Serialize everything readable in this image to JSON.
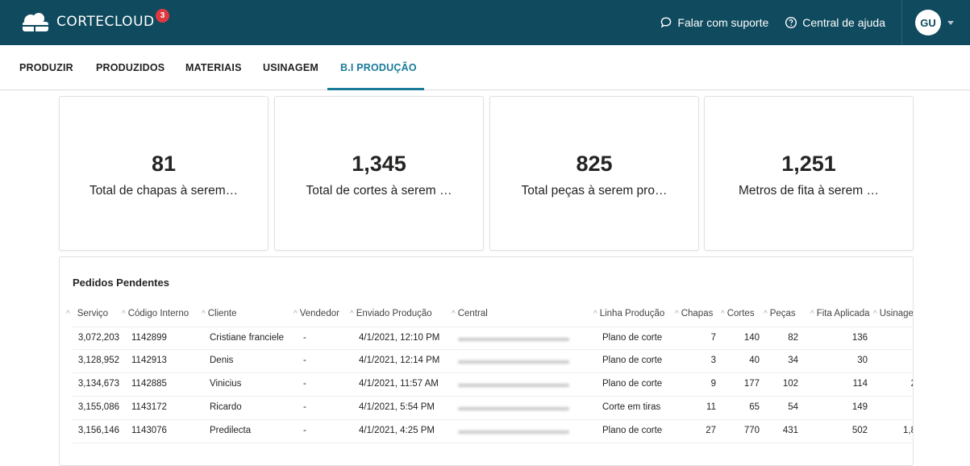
{
  "app": {
    "name": "CORTECLOUD",
    "notification_count": "3",
    "colors": {
      "topbar": "#0f4a5e",
      "accent": "#1a7a9a",
      "badge": "#e0383e"
    }
  },
  "header": {
    "support_label": "Falar com suporte",
    "help_label": "Central de ajuda",
    "user_initials": "GU"
  },
  "tabs": [
    {
      "label": "PRODUZIR"
    },
    {
      "label": "PRODUZIDOS"
    },
    {
      "label": "MATERIAIS"
    },
    {
      "label": "USINAGEM"
    },
    {
      "label": "B.I PRODUÇÃO",
      "active": true
    }
  ],
  "kpis": [
    {
      "value": "81",
      "label": "Total de chapas à serem…"
    },
    {
      "value": "1,345",
      "label": "Total de cortes à serem …"
    },
    {
      "value": "825",
      "label": "Total peças à serem pro…"
    },
    {
      "value": "1,251",
      "label": "Metros de fita à serem …"
    }
  ],
  "table": {
    "title": "Pedidos Pendentes",
    "columns": [
      "Serviço",
      "Código Interno",
      "Cliente",
      "Vendedor",
      "Enviado Produção",
      "Central",
      "Linha Produção",
      "Chapas",
      "Cortes",
      "Peças",
      "Fita Aplicada",
      "Usinage"
    ],
    "rows": [
      {
        "servico": "3,072,203",
        "codigo": "1142899",
        "cliente": "Cristiane franciele",
        "vendedor": "-",
        "enviado": "4/1/2021, 12:10 PM",
        "linha": "Plano de corte",
        "chapas": "7",
        "cortes": "140",
        "pecas": "82",
        "fita": "136",
        "usinagem": ""
      },
      {
        "servico": "3,128,952",
        "codigo": "1142913",
        "cliente": "Denis",
        "vendedor": "-",
        "enviado": "4/1/2021, 12:14 PM",
        "linha": "Plano de corte",
        "chapas": "3",
        "cortes": "40",
        "pecas": "34",
        "fita": "30",
        "usinagem": ""
      },
      {
        "servico": "3,134,673",
        "codigo": "1142885",
        "cliente": "Vinicius",
        "vendedor": "-",
        "enviado": "4/1/2021, 11:57 AM",
        "linha": "Plano de corte",
        "chapas": "9",
        "cortes": "177",
        "pecas": "102",
        "fita": "114",
        "usinagem": "2"
      },
      {
        "servico": "3,155,086",
        "codigo": "1143172",
        "cliente": "Ricardo",
        "vendedor": "-",
        "enviado": "4/1/2021, 5:54 PM",
        "linha": "Corte em tiras",
        "chapas": "11",
        "cortes": "65",
        "pecas": "54",
        "fita": "149",
        "usinagem": ""
      },
      {
        "servico": "3,156,146",
        "codigo": "1143076",
        "cliente": "Predilecta",
        "vendedor": "-",
        "enviado": "4/1/2021, 4:25 PM",
        "linha": "Plano de corte",
        "chapas": "27",
        "cortes": "770",
        "pecas": "431",
        "fita": "502",
        "usinagem": "1,8"
      }
    ]
  }
}
